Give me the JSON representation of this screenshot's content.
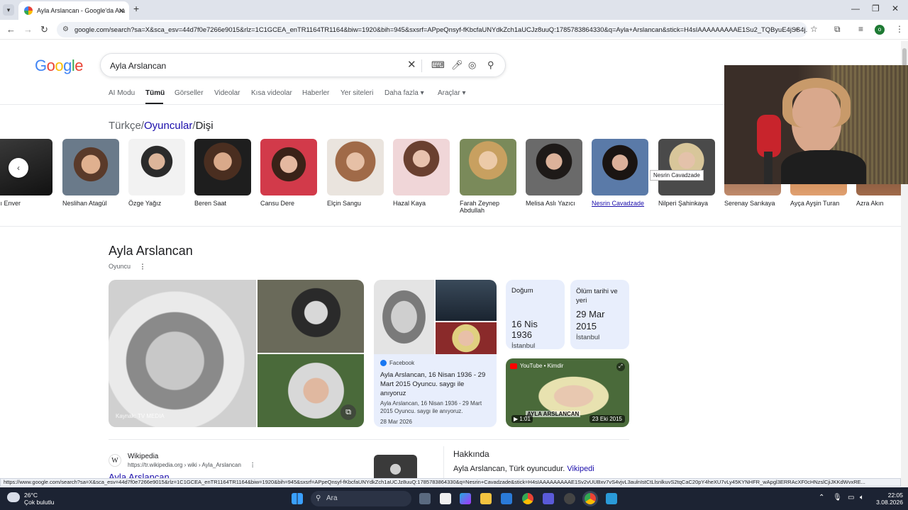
{
  "browser": {
    "tab_title": "Ayla Arslancan - Google'da Ara",
    "url": "google.com/search?sa=X&sca_esv=44d7f0e7266e9015&rlz=1C1GCEA_enTR1164TR1164&biw=1920&bih=945&sxsrf=APpeQnsyf-fKbcfaUNYdkZch1aUCJz8uuQ:1785783864330&q=Ayla+Arslancan&stick=H4sIAAAAAAAAAE1Su2_TQByuE4jSS4j...",
    "profile_initial": "o"
  },
  "google": {
    "logo": "Google",
    "query": "Ayla Arslancan",
    "tabs": [
      "AI Modu",
      "Tümü",
      "Görseller",
      "Videolar",
      "Kısa videolar",
      "Haberler",
      "Yer siteleri",
      "Daha fazla",
      "Araçlar"
    ]
  },
  "carousel": {
    "breadcrumb": [
      "Türkçe",
      "Oyuncular",
      "Dişi"
    ],
    "people": [
      "slı Enver",
      "Neslihan Atagül",
      "Özge Yağız",
      "Beren Saat",
      "Cansu Dere",
      "Elçin Sangu",
      "Hazal Kaya",
      "Farah Zeynep Abdullah",
      "Melisa Aslı Yazıcı",
      "Nesrin Cavadzade",
      "Nilperi Şahinkaya",
      "Serenay Sarıkaya",
      "Ayça Ayşin Turan",
      "Azra Akın"
    ],
    "tooltip": "Nesrin Cavadzade"
  },
  "knowledge": {
    "name": "Ayla Arslancan",
    "subtitle": "Oyuncu",
    "image_credit": "Kaynak: TV MEDIA",
    "birth": {
      "label": "Doğum",
      "date": "16 Nis 1936",
      "place": "İstanbul"
    },
    "death": {
      "label": "Ölüm tarihi ve yeri",
      "date": "29 Mar 2015",
      "place": "İstanbul"
    },
    "facebook": {
      "source": "Facebook",
      "title": "Ayla Arslancan, 16 Nisan 1936 - 29 Mart 2015 Oyuncu. saygı ile anıyoruz",
      "snippet": "Ayla Arslancan, 16 Nisan 1936 - 29 Mart 2015 Oyuncu. saygı ile anıyoruz.",
      "date": "28 Mar 2026"
    },
    "youtube": {
      "source": "YouTube • Kimdir",
      "caption": "AYLA ARSLANCAN",
      "duration": "1:01",
      "date": "23 Eki 2015"
    }
  },
  "wikipedia": {
    "site": "Wikipedia",
    "url": "https://tr.wikipedia.org › wiki › Ayla_Arslancan",
    "title": "Ayla Arslancan"
  },
  "about": {
    "heading": "Hakkında",
    "text": "Ayla Arslancan, Türk oyuncudur.",
    "link": "Vikipedi"
  },
  "status_url": "https://www.google.com/search?sa=X&sca_esv=44d7f0e7266e9015&rlz=1C1GCEA_enTR1164TR1164&biw=1920&bih=945&sxsrf=APpeQnsyf-fKbcfaUNYdkZch1aUCJz8uuQ:1785783864330&q=Nesrin+Cavadzade&stick=H4sIAAAAAAAAAE1Sv2vUUBxv7vS4vjvL3aulnIstCtLlsnlkuvS2tqCaC20pY4heXU7vLy45KYNHFR_wApgl3ERRAcXF0cHNzslCjiJKKdWvxRE...",
  "taskbar": {
    "temp": "26°C",
    "weather": "Çok bulutlu",
    "search": "Ara",
    "time": "22:05",
    "date": "3.08.2026"
  }
}
